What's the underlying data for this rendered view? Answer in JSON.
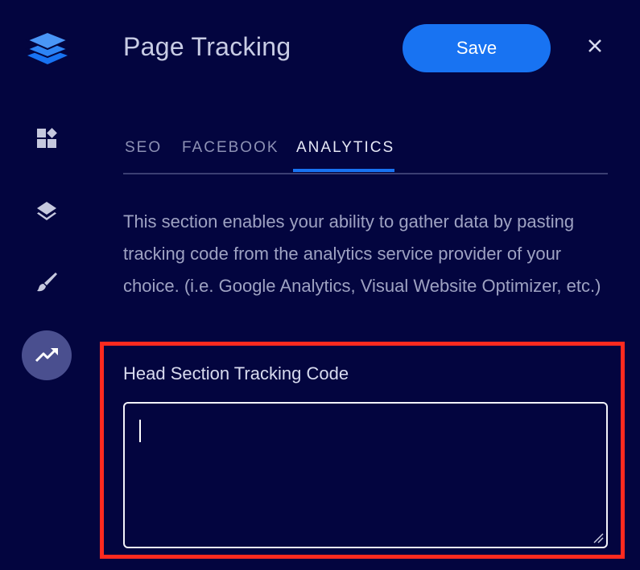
{
  "app": {
    "title": "Page Tracking",
    "save_label": "Save",
    "close_icon": "close-icon",
    "accent_color": "#1873f2",
    "background_color": "#03053f",
    "highlight_color": "#ff2a1f"
  },
  "sidebar": {
    "logo_icon": "layers-stack-logo-icon",
    "items": [
      {
        "icon": "widgets-icon",
        "active": false
      },
      {
        "icon": "layers-icon",
        "active": false
      },
      {
        "icon": "brush-icon",
        "active": false
      },
      {
        "icon": "trending-up-icon",
        "active": true
      }
    ]
  },
  "tabs": [
    {
      "label": "SEO",
      "active": false
    },
    {
      "label": "FACEBOOK",
      "active": false
    },
    {
      "label": "ANALYTICS",
      "active": true
    }
  ],
  "description": "This section enables your ability to gather data by pasting tracking code from the analytics service provider of your choice. (i.e. Google Analytics, Visual Website Optimizer, etc.)",
  "head_code": {
    "label": "Head Section Tracking Code",
    "value": ""
  }
}
